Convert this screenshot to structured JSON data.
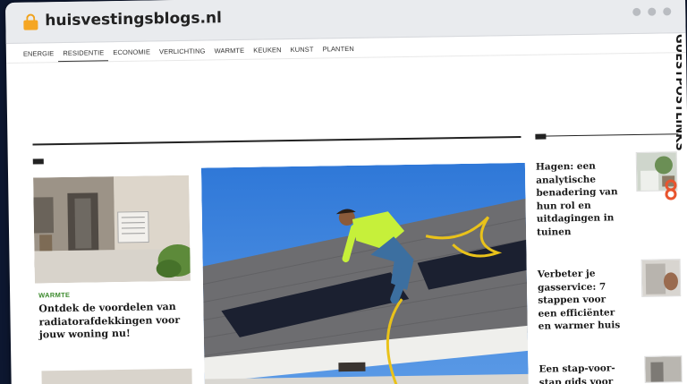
{
  "browser": {
    "domain": "huisvestingsblogs.nl"
  },
  "nav": [
    "ENERGIE",
    "RESIDENTIE",
    "ECONOMIE",
    "VERLICHTING",
    "WARMTE",
    "KEUKEN",
    "KUNST",
    "PLANTEN"
  ],
  "nav_active": "RESIDENTIE",
  "featured": {
    "category": "WARMTE",
    "title": "Ontdek de voordelen van radiatorafdekkingen voor jouw woning nu!"
  },
  "sidebar": [
    {
      "title": "Hagen: een analytische benadering van hun rol en uitdagingen in tuinen"
    },
    {
      "title": "Verbeter je gasservice: 7 stappen voor een efficiënter en warmer huis"
    },
    {
      "title": "Een stap-voor-stap gids voor het"
    }
  ],
  "watermark": "GUESTPOSTLINKS",
  "colors": {
    "accent_category": "#3b8a2c",
    "lock": "#f5a623",
    "brand": "#e8542e"
  }
}
